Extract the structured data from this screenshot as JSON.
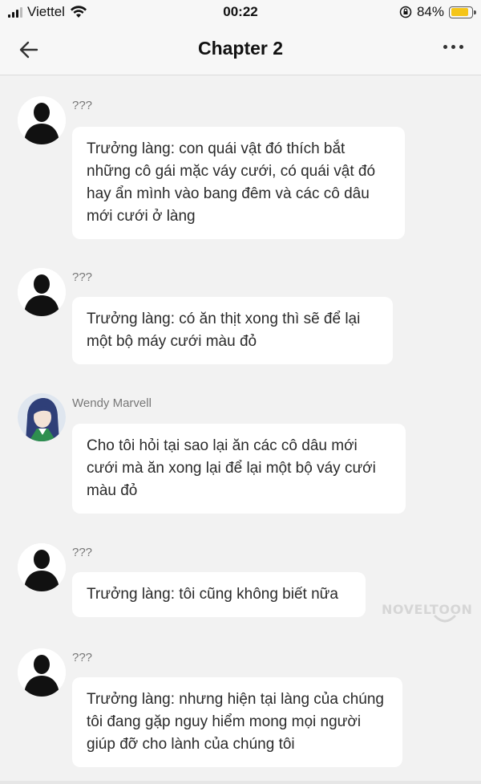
{
  "status_bar": {
    "carrier": "Viettel",
    "time": "00:22",
    "battery_percent": "84%",
    "battery_level": 0.84,
    "battery_color": "#f5c518"
  },
  "nav": {
    "title": "Chapter 2",
    "back_icon": "arrow-left-icon",
    "more_icon": "more-dots-icon"
  },
  "messages": [
    {
      "sender": "???",
      "avatar": "silhouette-avatar",
      "text": "Trưởng làng: con quái vật đó thích bắt những cô gái mặc váy cưới, có quái vật đó hay ẩn mình vào bang đêm và các cô dâu mới cưới ở làng"
    },
    {
      "sender": "???",
      "avatar": "silhouette-avatar",
      "text": "Trưởng làng: có ăn thịt xong thì sẽ để lại một bộ máy cưới màu đỏ"
    },
    {
      "sender": "Wendy Marvell",
      "avatar": "character-avatar",
      "text": "Cho tôi hỏi tại sao lại ăn các cô dâu mới cưới mà ăn xong lại để lại một bộ váy cưới màu đỏ"
    },
    {
      "sender": "???",
      "avatar": "silhouette-avatar",
      "text": "Trưởng làng: tôi cũng không biết nữa"
    },
    {
      "sender": "???",
      "avatar": "silhouette-avatar",
      "text": "Trưởng làng: nhưng hiện tại làng của chúng tôi đang gặp nguy hiểm mong mọi người giúp đỡ cho lành của chúng tôi"
    }
  ],
  "watermark": "NOVELTOON"
}
